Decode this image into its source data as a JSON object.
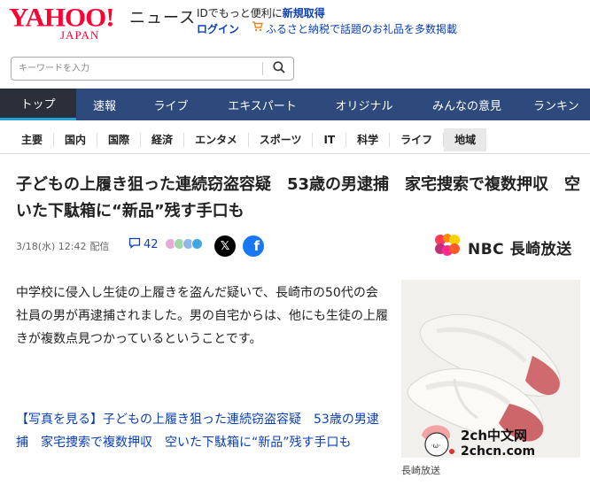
{
  "header": {
    "logo_text": "YAHOO!",
    "logo_sub": "JAPAN",
    "section": "ニュース",
    "promo_line1_prefix": "IDでもっと便利に",
    "promo_line1_link": "新規取得",
    "login": "ログイン",
    "promo_line2": "ふるさと納税で話題のお礼品を多数掲載",
    "brand_color": "#ff0033"
  },
  "search": {
    "placeholder": "キーワードを入力",
    "icon": "search-icon"
  },
  "mainnav": {
    "items": [
      {
        "label": "トップ",
        "active": true
      },
      {
        "label": "速報"
      },
      {
        "label": "ライブ"
      },
      {
        "label": "エキスパート"
      },
      {
        "label": "オリジナル"
      },
      {
        "label": "みんなの意見"
      },
      {
        "label": "ランキン"
      }
    ]
  },
  "subnav": {
    "items": [
      {
        "label": "主要"
      },
      {
        "label": "国内"
      },
      {
        "label": "国際"
      },
      {
        "label": "経済"
      },
      {
        "label": "エンタメ"
      },
      {
        "label": "スポーツ"
      },
      {
        "label": "IT"
      },
      {
        "label": "科学"
      },
      {
        "label": "ライフ"
      },
      {
        "label": "地域",
        "active": true
      }
    ]
  },
  "article": {
    "headline": "子どもの上履き狙った連続窃盗容疑　53歳の男逮捕　家宅捜索で複数押収　空いた下駄箱に“新品”残す手口も",
    "date": "3/18(水) 12:42",
    "delivery": "配信",
    "comment_count": "42",
    "publisher": "NBC 長崎放送",
    "body": "中学校に侵入し生徒の上履きを盗んだ疑いで、長崎市の50代の会社員の男が再逮捕されました。男の自宅からは、他にも生徒の上履きが複数点見つかっているということです。",
    "photo_link": "【写真を見る】子どもの上履き狙った連続窃盗容疑　53歳の男逮捕　家宅捜索で複数押収　空いた下駄箱に“新品”残す手口も",
    "photo_caption": "長崎放送"
  },
  "watermark": {
    "line1": "2ch中文网",
    "line2": "2chcn.com"
  },
  "colors": {
    "nav_bg": "#2e4a7d",
    "nav_active": "#2b2f3a",
    "link": "#0a3fb5",
    "x_black": "#000000",
    "facebook": "#1877f2"
  }
}
